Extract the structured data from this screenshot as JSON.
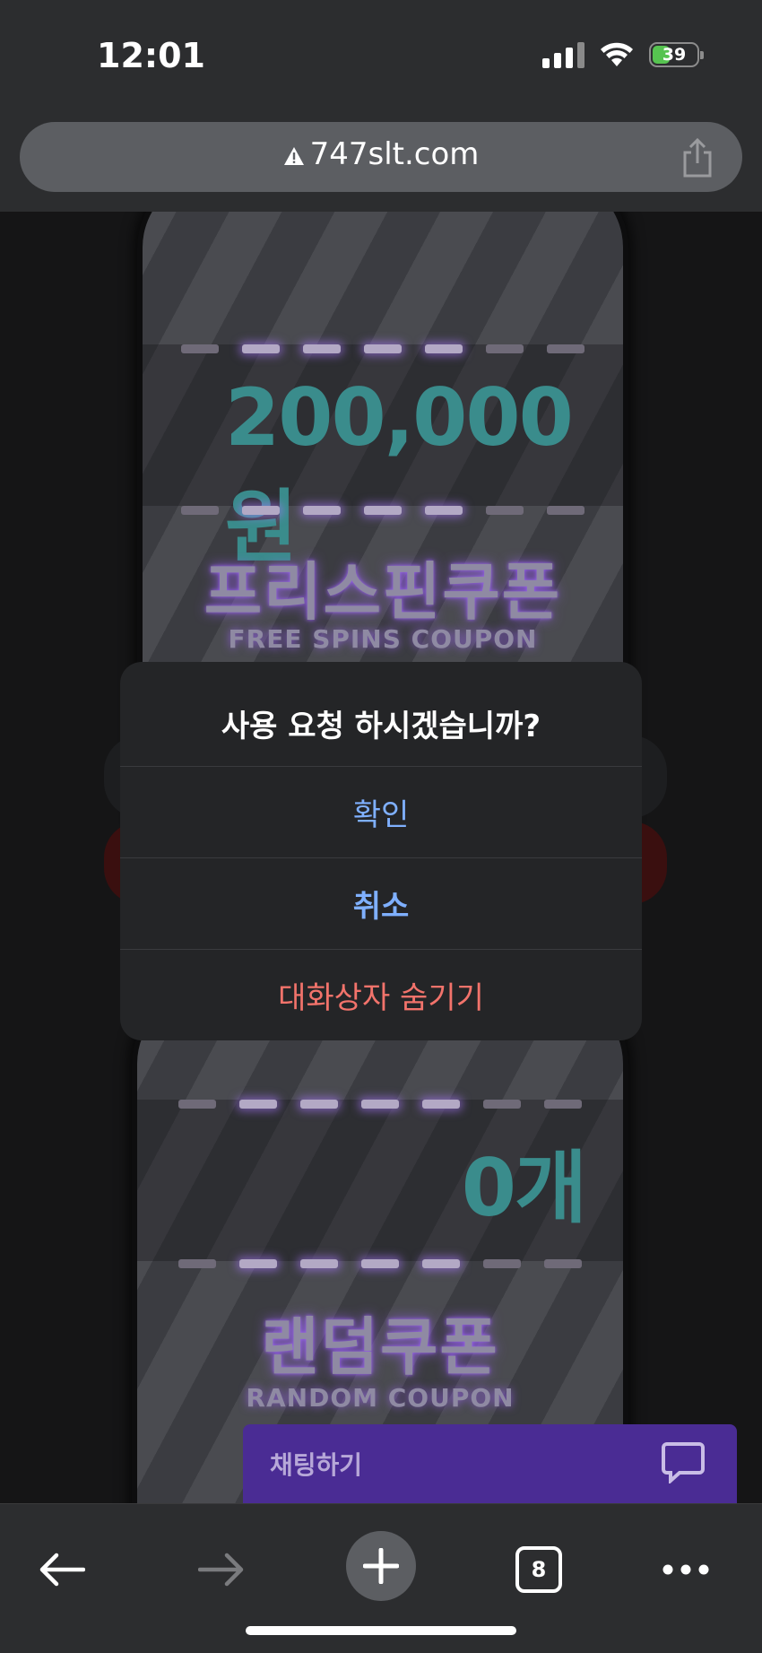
{
  "status_bar": {
    "time": "12:01",
    "battery_percent": "39",
    "battery_level": 0.39,
    "battery_charging": true
  },
  "browser": {
    "url": "747slt.com",
    "url_insecure_icon": "warning-triangle-icon",
    "share_icon": "share-icon",
    "open_tabs": "8"
  },
  "page": {
    "free_spins_card": {
      "amount": "200,000원",
      "title_kr": "프리스핀쿠폰",
      "title_en": "FREE SPINS COUPON"
    },
    "random_card": {
      "amount": "0개",
      "title_kr": "랜덤쿠폰",
      "title_en": "RANDOM COUPON"
    },
    "chat_button": {
      "label": "채팅하기",
      "icon": "chat-bubble-icon"
    }
  },
  "dialog": {
    "message": "사용 요청 하시겠습니까?",
    "confirm": "확인",
    "cancel": "취소",
    "hide": "대화상자 숨기기"
  },
  "colors": {
    "accent_blue": "#7fb0ff",
    "destructive_red": "#f2736b",
    "amount_teal": "#3a8c8c",
    "chat_purple": "#4a2c94"
  }
}
